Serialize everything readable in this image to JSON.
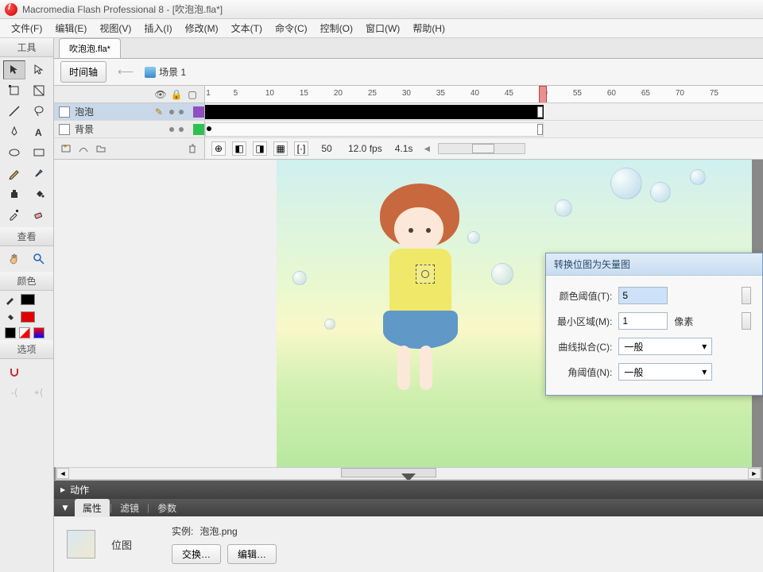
{
  "app": {
    "title": "Macromedia Flash Professional 8 - [吹泡泡.fla*]"
  },
  "menu": [
    "文件(F)",
    "编辑(E)",
    "视图(V)",
    "插入(I)",
    "修改(M)",
    "文本(T)",
    "命令(C)",
    "控制(O)",
    "窗口(W)",
    "帮助(H)"
  ],
  "doc_tab": "吹泡泡.fla*",
  "scene_bar": {
    "timeline_btn": "时间轴",
    "scene_label": "场景 1"
  },
  "tool_sections": {
    "tools": "工具",
    "view": "查看",
    "colors": "颜色",
    "options": "选项"
  },
  "timeline": {
    "ruler_marks": [
      "1",
      "5",
      "10",
      "15",
      "20",
      "25",
      "30",
      "35",
      "40",
      "45",
      "50",
      "55",
      "60",
      "65",
      "70",
      "75"
    ],
    "layers": [
      {
        "name": "泡泡",
        "color": "#9050c0",
        "selected": true
      },
      {
        "name": "背景",
        "color": "#30c050",
        "selected": false
      }
    ],
    "current_frame": "50",
    "fps": "12.0 fps",
    "elapsed": "4.1s"
  },
  "dialog": {
    "title": "转换位图为矢量图",
    "color_threshold_label": "颜色阈值(T):",
    "color_threshold_value": "5",
    "min_area_label": "最小区域(M):",
    "min_area_value": "1",
    "min_area_unit": "像素",
    "curve_fit_label": "曲线拟合(C):",
    "curve_fit_value": "一般",
    "corner_threshold_label": "角阈值(N):",
    "corner_threshold_value": "一般"
  },
  "bottom": {
    "actions_panel": "动作",
    "tabs": [
      "属性",
      "滤镜",
      "参数"
    ],
    "prop_type": "位图",
    "instance_label": "实例:",
    "instance_name": "泡泡.png",
    "swap_btn": "交换…",
    "edit_btn": "编辑…"
  }
}
